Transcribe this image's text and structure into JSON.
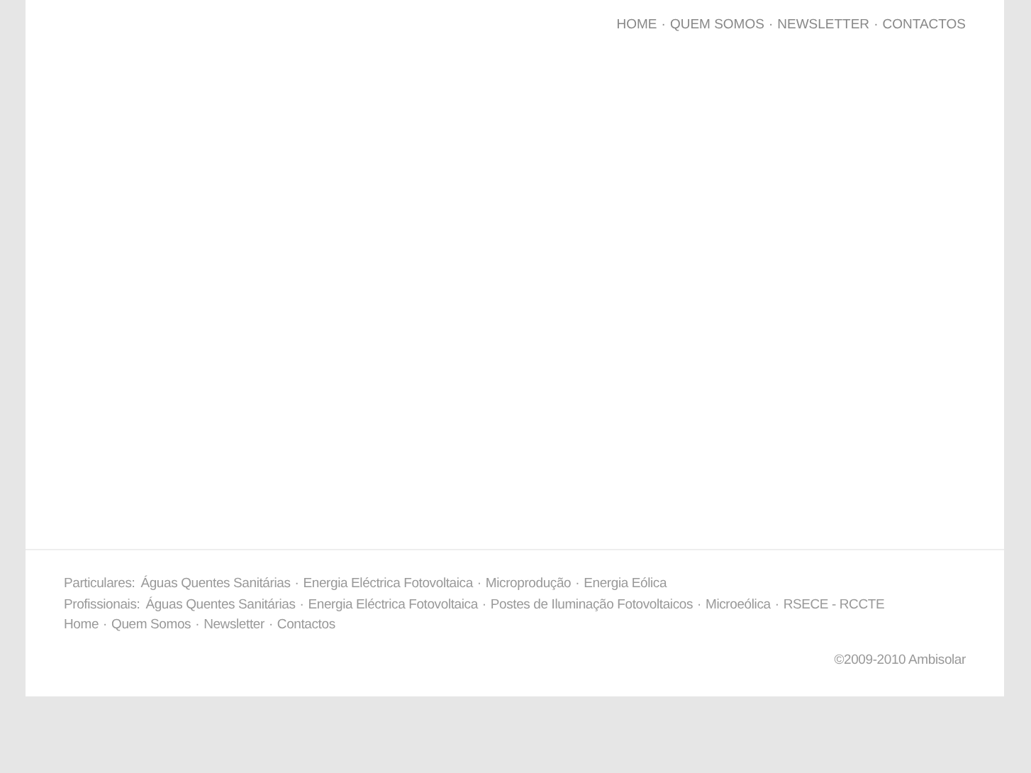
{
  "top_nav": {
    "separator": "·",
    "links": [
      "HOME",
      "QUEM SOMOS",
      "NEWSLETTER",
      "CONTACTOS"
    ]
  },
  "footer": {
    "separator": "·",
    "rows": [
      {
        "label": "Particulares:",
        "links": [
          "Águas Quentes Sanitárias",
          "Energia Eléctrica Fotovoltaica",
          "Microprodução",
          "Energia Eólica"
        ]
      },
      {
        "label": "Profissionais:",
        "links": [
          "Águas Quentes Sanitárias",
          "Energia Eléctrica Fotovoltaica",
          "Postes de Iluminação Fotovoltaicos",
          "Microeólica",
          "RSECE - RCCTE"
        ]
      },
      {
        "links": [
          "Home",
          "Quem Somos",
          "Newsletter",
          "Contactos"
        ]
      }
    ],
    "copyright": "©2009-2010 Ambisolar"
  }
}
